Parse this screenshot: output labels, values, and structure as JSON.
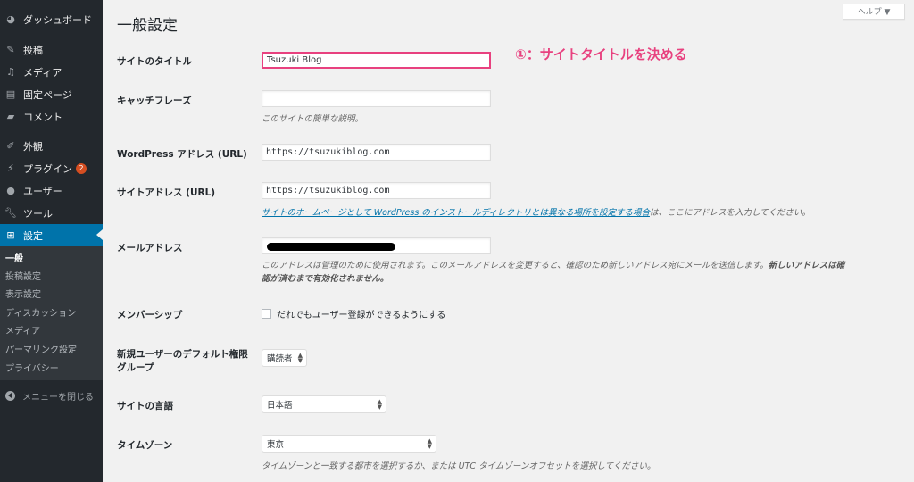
{
  "sidebar": {
    "items": [
      {
        "label": "ダッシュボード"
      },
      {
        "label": "投稿"
      },
      {
        "label": "メディア"
      },
      {
        "label": "固定ページ"
      },
      {
        "label": "コメント"
      },
      {
        "label": "外観"
      },
      {
        "label": "プラグイン",
        "badge": "2"
      },
      {
        "label": "ユーザー"
      },
      {
        "label": "ツール"
      },
      {
        "label": "設定"
      }
    ],
    "submenu": [
      "一般",
      "投稿設定",
      "表示設定",
      "ディスカッション",
      "メディア",
      "パーマリンク設定",
      "プライバシー"
    ],
    "collapse_label": "メニューを閉じる",
    "accent": "#0073aa",
    "background": "#23282d"
  },
  "header": {
    "title": "一般設定",
    "help_label": "ヘルプ ▼"
  },
  "form": {
    "site_title": {
      "label": "サイトのタイトル",
      "value": "Tsuzuki Blog"
    },
    "tagline": {
      "label": "キャッチフレーズ",
      "value": "",
      "description": "このサイトの簡単な説明。"
    },
    "wp_address": {
      "label": "WordPress アドレス (URL)",
      "value": "https://tsuzukiblog.com"
    },
    "site_address": {
      "label": "サイトアドレス (URL)",
      "value": "https://tsuzukiblog.com",
      "link_text": "サイトのホームページとして WordPress のインストールディレクトリとは異なる場所を設定する場合",
      "desc_suffix": "は、ここにアドレスを入力してください。"
    },
    "email": {
      "label": "メールアドレス",
      "desc_plain": "このアドレスは管理のために使用されます。このメールアドレスを変更すると、確認のため新しいアドレス宛にメールを送信します。",
      "desc_bold_1": "新しいアドレスは確",
      "desc_bold_2": "認が済むまで有効化されません。"
    },
    "membership": {
      "label": "メンバーシップ",
      "checkbox_label": "だれでもユーザー登録ができるようにする",
      "checked": false
    },
    "default_role": {
      "label_1": "新規ユーザーのデフォルト権限",
      "label_2": "グループ",
      "value": "購読者"
    },
    "language": {
      "label": "サイトの言語",
      "value": "日本語"
    },
    "timezone": {
      "label": "タイムゾーン",
      "value": "東京",
      "description": "タイムゾーンと一致する都市を選択するか、または UTC タイムゾーンオフセットを選択してください。"
    }
  },
  "annotation": {
    "text": "①：サイトタイトルを決める",
    "color": "#e8417f"
  }
}
